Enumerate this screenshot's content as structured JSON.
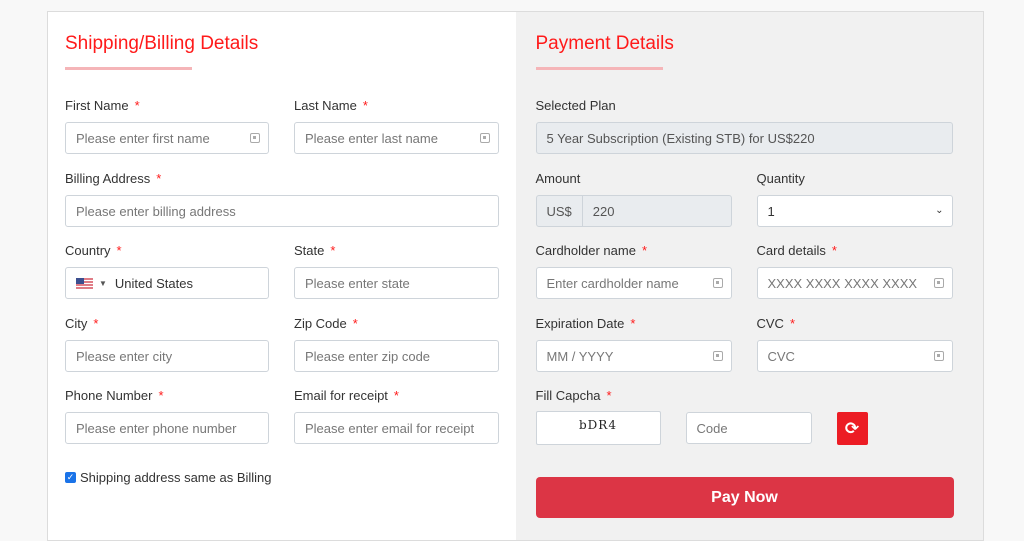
{
  "shipping": {
    "title": "Shipping/Billing Details",
    "first_name": {
      "label": "First Name",
      "placeholder": "Please enter first name"
    },
    "last_name": {
      "label": "Last Name",
      "placeholder": "Please enter last name"
    },
    "billing_address": {
      "label": "Billing Address",
      "placeholder": "Please enter billing address"
    },
    "country": {
      "label": "Country",
      "value": "United States"
    },
    "state": {
      "label": "State",
      "placeholder": "Please enter state"
    },
    "city": {
      "label": "City",
      "placeholder": "Please enter city"
    },
    "zip": {
      "label": "Zip Code",
      "placeholder": "Please enter zip code"
    },
    "phone": {
      "label": "Phone Number",
      "placeholder": "Please enter phone number"
    },
    "email": {
      "label": "Email for receipt",
      "placeholder": "Please enter email for receipt"
    },
    "same_as_billing": {
      "label": "Shipping address same as Billing",
      "checked": true
    },
    "required_mark": "*"
  },
  "payment": {
    "title": "Payment Details",
    "selected_plan": {
      "label": "Selected Plan",
      "value": "5 Year Subscription (Existing STB) for US$220"
    },
    "amount": {
      "label": "Amount",
      "currency": "US$",
      "value": "220"
    },
    "quantity": {
      "label": "Quantity",
      "value": "1"
    },
    "cardholder": {
      "label": "Cardholder name",
      "placeholder": "Enter cardholder name"
    },
    "card_details": {
      "label": "Card details",
      "placeholder": "XXXX XXXX XXXX XXXX"
    },
    "expiration": {
      "label": "Expiration Date",
      "placeholder": "MM / YYYY"
    },
    "cvc": {
      "label": "CVC",
      "placeholder": "CVC"
    },
    "captcha": {
      "label": "Fill Capcha",
      "image_text": "bDR4",
      "placeholder": "Code"
    },
    "pay_button": "Pay Now"
  },
  "colors": {
    "accent": "#ff1a1a",
    "pay_button": "#dc3545",
    "refresh_button": "#ec1c24"
  }
}
